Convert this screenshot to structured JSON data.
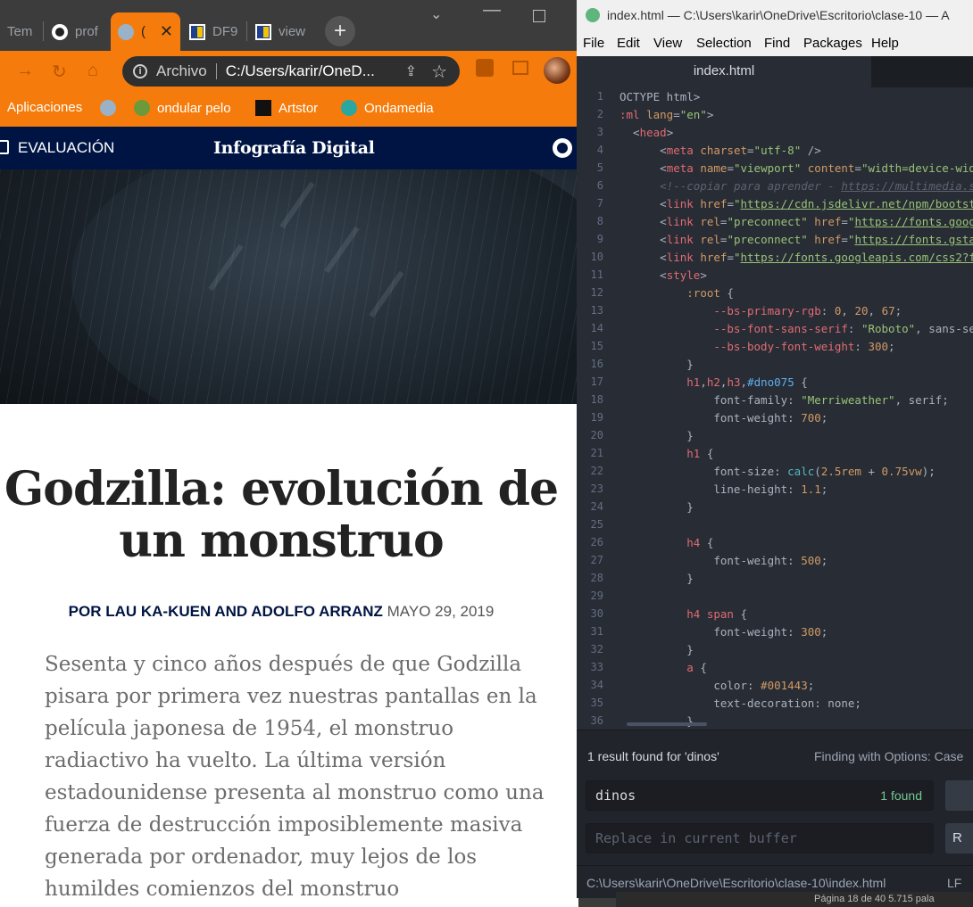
{
  "browser": {
    "tabs": [
      {
        "label": "Tem"
      },
      {
        "label": "prof"
      },
      {
        "label": "("
      },
      {
        "label": "DF9"
      },
      {
        "label": "view"
      }
    ],
    "new_tab": "+",
    "omnibox": {
      "info_label": "Archivo",
      "url": "C:/Users/karir/OneD..."
    },
    "bookmarks": [
      {
        "label": "Aplicaciones"
      },
      {
        "label": "ondular pelo"
      },
      {
        "label": "Artstor"
      },
      {
        "label": "Ondamedia"
      }
    ]
  },
  "page": {
    "nav": {
      "left_link": "EVALUACIÓN",
      "title": "Infografía Digital"
    },
    "headline": "Godzilla: evolución de un monstruo",
    "byline": {
      "prefix_authors": "POR LAU KA-KUEN AND ADOLFO ARRANZ",
      "date": "MAYO 29, 2019"
    },
    "lead": "Sesenta y cinco años después de que Godzilla pisara por primera vez nuestras pantallas en la película japonesa de 1954, el monstruo radiactivo ha vuelto. La última versión estadounidense presenta al monstruo como una fuerza de destrucción imposiblemente masiva generada por ordenador, muy lejos de los humildes comienzos del monstruo"
  },
  "editor": {
    "window_title": "index.html — C:\\Users\\karir\\OneDrive\\Escritorio\\clase-10 — A",
    "menu": [
      "File",
      "Edit",
      "View",
      "Selection",
      "Find",
      "Packages",
      "Help"
    ],
    "file_tab": "index.html",
    "line_numbers": [
      "1",
      "2",
      "3",
      "4",
      "5",
      "6",
      "7",
      "8",
      "9",
      "10",
      "11",
      "12",
      "13",
      "14",
      "15",
      "16",
      "17",
      "18",
      "19",
      "20",
      "21",
      "22",
      "23",
      "24",
      "25",
      "26",
      "27",
      "28",
      "29",
      "30",
      "31",
      "32",
      "33",
      "34",
      "35",
      "36"
    ],
    "find": {
      "result": "1 result found for 'dinos'",
      "options": "Finding with Options: Case",
      "query": "dinos",
      "count": "1 found",
      "replace_placeholder": "Replace in current buffer",
      "replace_btn": "R"
    },
    "status": {
      "path": "C:\\Users\\karir\\OneDrive\\Escritorio\\clase-10\\index.html",
      "line_ending": "LF"
    }
  },
  "background_window": {
    "text": "Página 18 de 40    5.715 pala"
  },
  "colors": {
    "browser_accent": "#f57c0c",
    "site_nav": "#001443",
    "editor_bg": "#282c34"
  }
}
